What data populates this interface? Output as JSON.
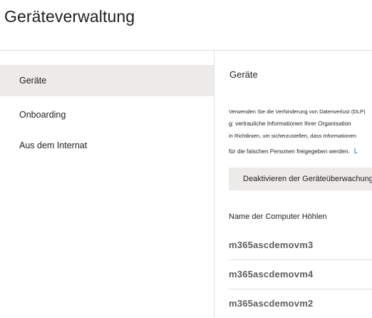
{
  "page": {
    "title": "Geräteverwaltung"
  },
  "nav": {
    "items": [
      {
        "label": "Geräte",
        "selected": true
      },
      {
        "label": "Onboarding",
        "selected": false
      },
      {
        "label": "Aus dem Internat",
        "selected": false
      }
    ]
  },
  "pane": {
    "title": "Geräte",
    "description": {
      "line1": "Verwenden Sie die Verhinderung von Datenverlust (DLP)",
      "line2": "g: vertrauliche Informationen Ihrer Organisation",
      "line3": "in Richtlinien, um sicherzustellen, dass Informationen",
      "line4": "für die falschen Personen freigegeben werden.",
      "link": "L"
    },
    "action_button": "Deaktivieren der Geräteüberwachung",
    "table": {
      "column_header": "Name der Computer Höhlen",
      "rows": [
        "m365ascdemovm3",
        "m365ascdemovm4",
        "m365ascdemovm2"
      ]
    }
  },
  "colors": {
    "selected_bg": "#edebe9",
    "divider": "#e1dfdd",
    "link": "#0078d4",
    "row_text": "#605e5c"
  }
}
